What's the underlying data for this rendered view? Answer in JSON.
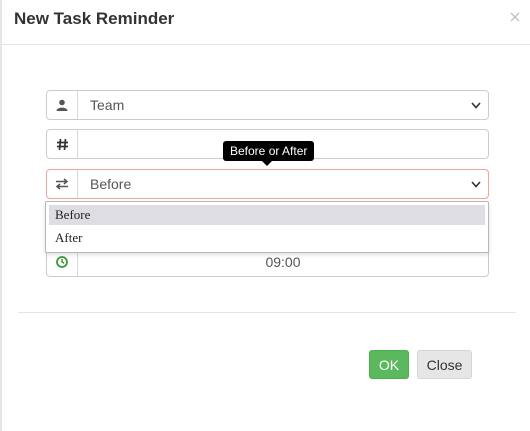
{
  "dialog": {
    "title": "New Task Reminder",
    "close_icon": "close-icon"
  },
  "form": {
    "target": {
      "icon": "user-icon",
      "value": "Team"
    },
    "amount": {
      "icon": "hash-icon",
      "value": ""
    },
    "direction": {
      "icon": "swap-arrows-icon",
      "value": "Before",
      "tooltip": "Before or After"
    },
    "direction_options": [
      {
        "label": "Before",
        "selected": true
      },
      {
        "label": "After",
        "selected": false
      }
    ],
    "time": {
      "icon": "clock-icon",
      "value": "09:00"
    }
  },
  "buttons": {
    "ok_label": "OK",
    "close_label": "Close"
  },
  "colors": {
    "ok_green": "#5cb85c",
    "clock_green": "#3a9a3a",
    "active_border": "#e8a89a"
  }
}
